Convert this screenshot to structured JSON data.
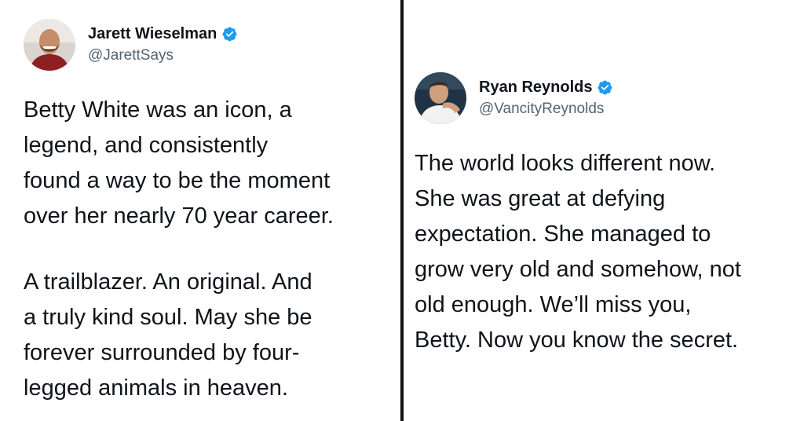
{
  "tweets": [
    {
      "display_name": "Jarett Wieselman",
      "handle": "@JarettSays",
      "verified": true,
      "verified_icon": "verified-badge-icon",
      "paragraphs": [
        "Betty White was an icon, a\nlegend, and consistently\nfound a way to be the moment\nover her nearly 70 year career.",
        "A trailblazer. An original. And\na truly kind soul. May she be\nforever surrounded by four-\nlegged animals in heaven."
      ]
    },
    {
      "display_name": "Ryan Reynolds",
      "handle": "@VancityReynolds",
      "verified": true,
      "verified_icon": "verified-badge-icon",
      "paragraphs": [
        "The world looks different now.\nShe was great at defying\nexpectation. She managed to\ngrow very old and somehow, not\nold enough. We’ll miss you,\nBetty. Now you know the secret."
      ]
    }
  ],
  "colors": {
    "text": "#0f1419",
    "handle": "#536471",
    "verified": "#1d9bf0",
    "divider": "#111111",
    "background": "#ffffff"
  }
}
